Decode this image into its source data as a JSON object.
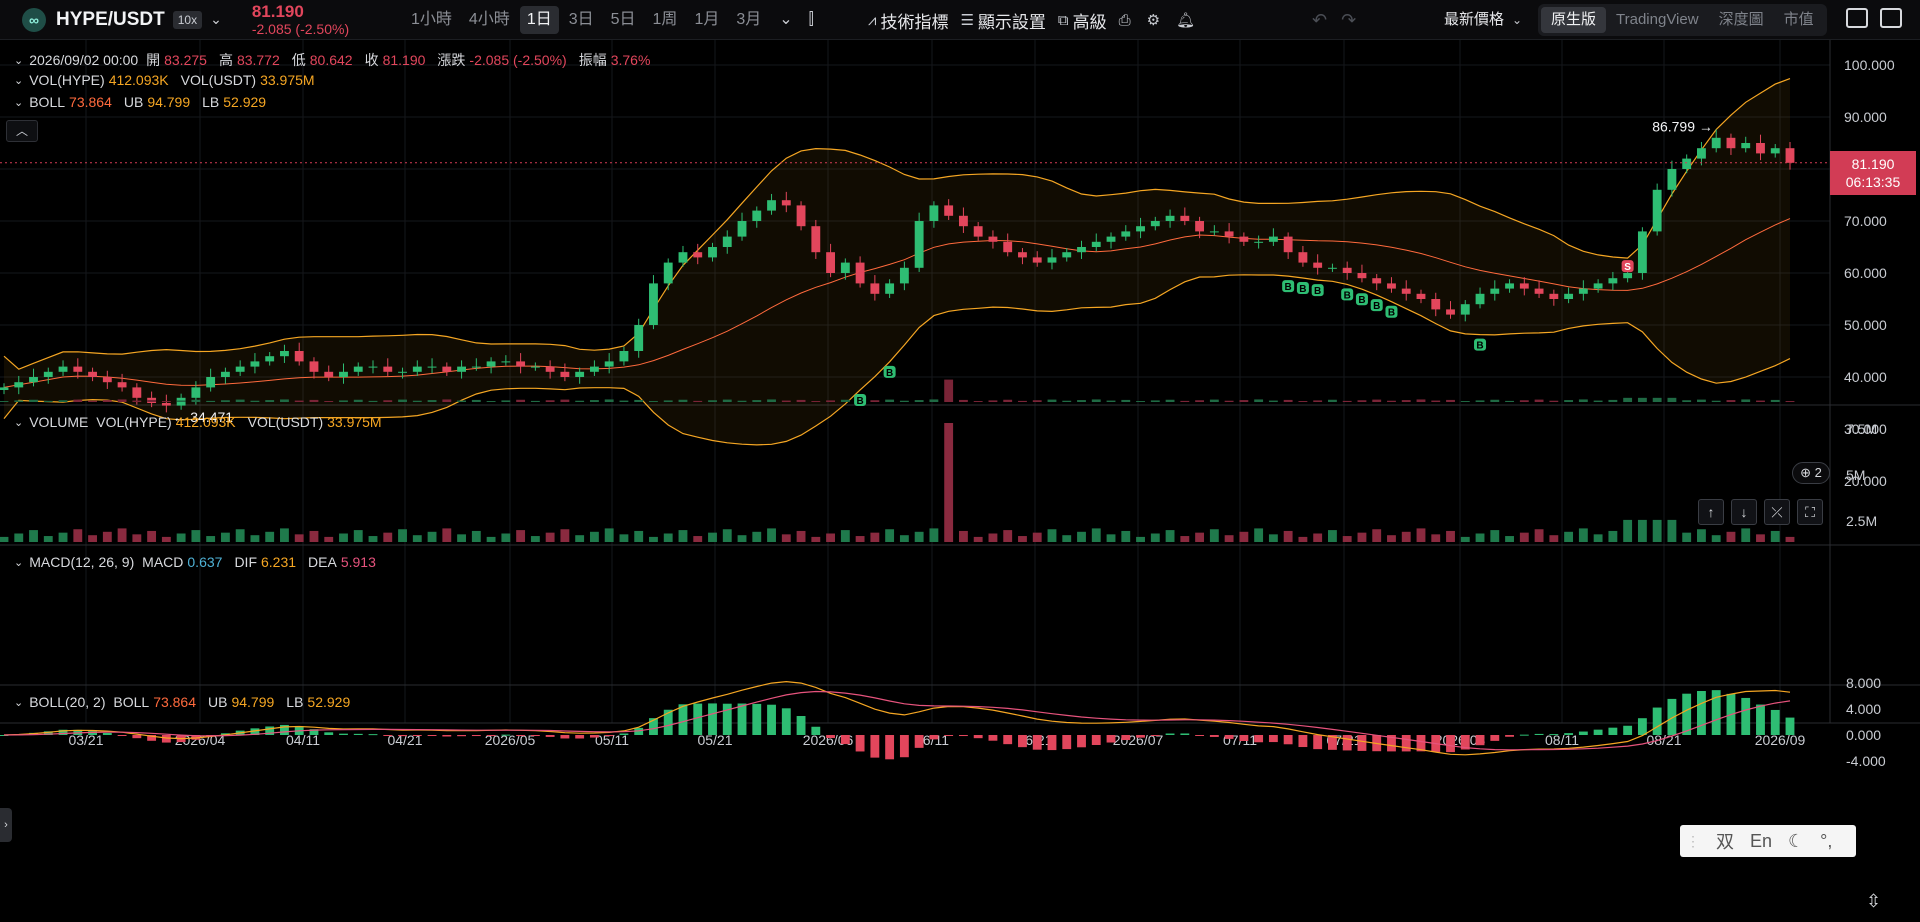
{
  "header": {
    "pair": "HYPE/USDT",
    "leverage": "10x",
    "last_price": "81.190",
    "change": "-2.085 (-2.50%)",
    "intervals": [
      "1小時",
      "4小時",
      "1日",
      "3日",
      "5日",
      "1周",
      "1月",
      "3月"
    ],
    "active_interval": "1日",
    "tools": {
      "indicators": "技術指標",
      "display": "顯示設置",
      "advanced": "高級"
    },
    "price_type": "最新價格",
    "views": [
      "原生版",
      "TradingView",
      "深度圖",
      "市值"
    ],
    "active_view": "原生版"
  },
  "legend": {
    "date": "2026/09/02 00:00",
    "open_label": "開",
    "open": "83.275",
    "high_label": "高",
    "high": "83.772",
    "low_label": "低",
    "low": "80.642",
    "close_label": "收",
    "close": "81.190",
    "change_label": "漲跌",
    "change": "-2.085 (-2.50%)",
    "amp_label": "振幅",
    "amp": "3.76%",
    "vol_line": {
      "k1": "VOL(HYPE)",
      "v1": "412.093K",
      "k2": "VOL(USDT)",
      "v2": "33.975M"
    },
    "boll_line": {
      "k1": "BOLL",
      "v1": "73.864",
      "k2": "UB",
      "v2": "94.799",
      "k3": "LB",
      "v3": "52.929"
    }
  },
  "volume_pane": {
    "title": "VOLUME",
    "k1": "VOL(HYPE)",
    "v1": "412.093K",
    "k2": "VOL(USDT)",
    "v2": "33.975M",
    "axis": [
      "7.5M",
      "5M",
      "2.5M"
    ]
  },
  "macd_pane": {
    "title": "MACD(12, 26, 9)",
    "k1": "MACD",
    "v1": "0.637",
    "k2": "DIF",
    "v2": "6.231",
    "k3": "DEA",
    "v3": "5.913",
    "axis": [
      "8.000",
      "4.000",
      "0.000",
      "-4.000"
    ]
  },
  "boll_pane": {
    "title": "BOLL(20, 2)",
    "k1": "BOLL",
    "v1": "73.864",
    "k2": "UB",
    "v2": "94.799",
    "k3": "LB",
    "v3": "52.929"
  },
  "price_axis": [
    "100.000",
    "90.000",
    "80.000",
    "70.000",
    "60.000",
    "50.000",
    "40.000",
    "30.000",
    "20.000"
  ],
  "price_tag": {
    "price": "81.190",
    "countdown": "06:13:35"
  },
  "markers": {
    "high_label": "86.799",
    "low_label": "34.471",
    "buy": "B",
    "sell": "S",
    "globe_count": "2"
  },
  "time_axis": [
    "03/21",
    "2026/04",
    "04/11",
    "04/21",
    "2026/05",
    "05/11",
    "05/21",
    "2026/06",
    "06/11",
    "06/21",
    "2026/07",
    "07/11",
    "07/21",
    "2026/08",
    "08/11",
    "08/21",
    "2026/09"
  ],
  "ime": {
    "a": "双",
    "b": "En"
  },
  "colors": {
    "up": "#2ebd73",
    "down": "#e2465c",
    "band": "#f5a623",
    "mid": "#ff6a3d",
    "background": "#000000"
  },
  "chart_data": {
    "type": "candlestick",
    "price_range": [
      20,
      100
    ],
    "approx_daily_closes": [
      38,
      39,
      40,
      41,
      42,
      41,
      40,
      39,
      38,
      36,
      35,
      34.5,
      36,
      38,
      40,
      41,
      42,
      43,
      44,
      45,
      43,
      41,
      40,
      41,
      42,
      42,
      41,
      41,
      42,
      42,
      41,
      42,
      42,
      43,
      43,
      42,
      42,
      41,
      40,
      41,
      42,
      43,
      45,
      50,
      58,
      62,
      64,
      63,
      65,
      67,
      70,
      72,
      74,
      73,
      69,
      64,
      60,
      62,
      58,
      56,
      58,
      61,
      70,
      73,
      71,
      69,
      67,
      66,
      64,
      63,
      62,
      63,
      64,
      65,
      66,
      67,
      68,
      69,
      70,
      71,
      70,
      68,
      68,
      67,
      66,
      66,
      67,
      64,
      62,
      61,
      61,
      60,
      59,
      58,
      57,
      56,
      55,
      53,
      52,
      54,
      56,
      57,
      58,
      57,
      56,
      55,
      56,
      57,
      58,
      59,
      60,
      68,
      76,
      80,
      82,
      84,
      86,
      84,
      85,
      83,
      84,
      81.19
    ]
  }
}
